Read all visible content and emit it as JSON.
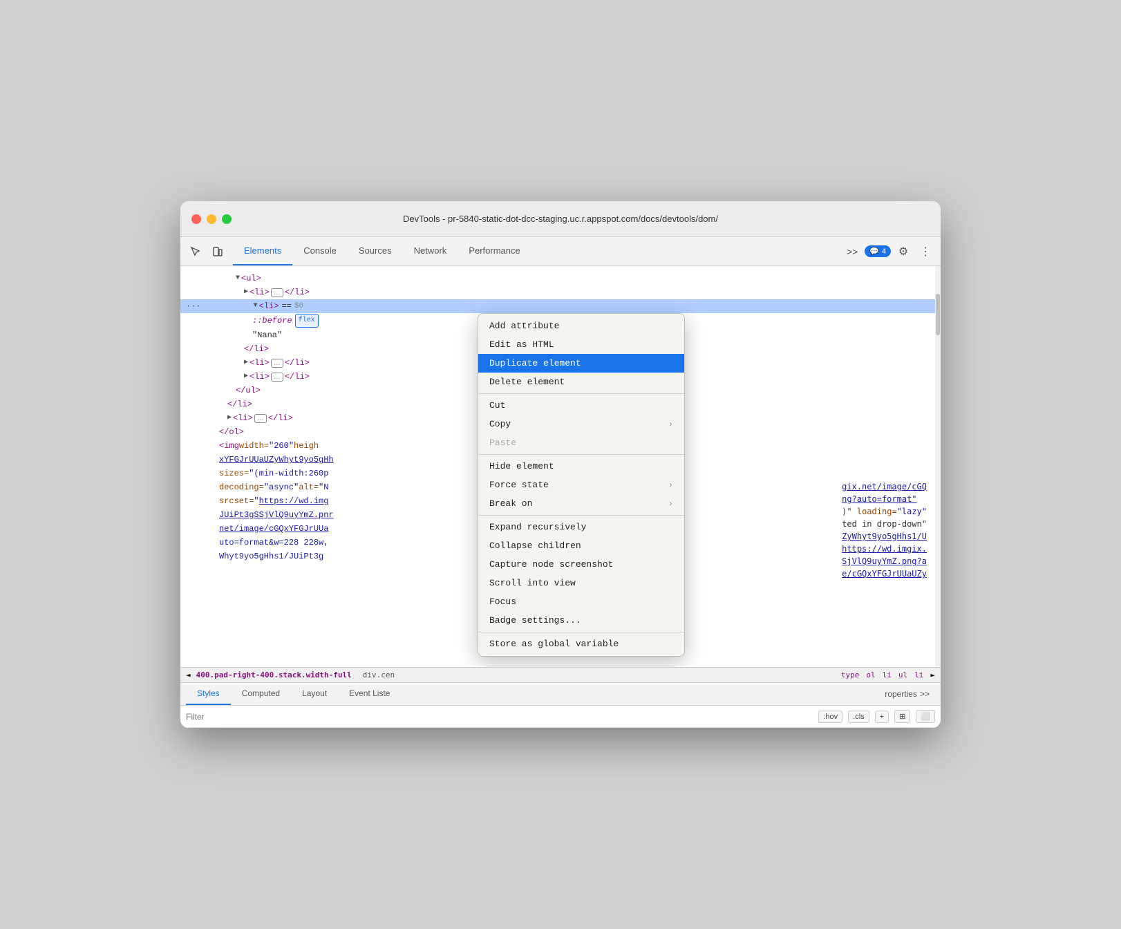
{
  "window": {
    "title": "DevTools - pr-5840-static-dot-dcc-staging.uc.r.appspot.com/docs/devtools/dom/"
  },
  "toolbar": {
    "tabs": [
      {
        "label": "Elements",
        "active": true
      },
      {
        "label": "Console",
        "active": false
      },
      {
        "label": "Sources",
        "active": false
      },
      {
        "label": "Network",
        "active": false
      },
      {
        "label": "Performance",
        "active": false
      }
    ],
    "more_label": ">>",
    "console_badge": "4",
    "settings_icon": "⚙",
    "more_icon": "⋮"
  },
  "dom": {
    "lines": [
      {
        "indent": 6,
        "content": "<ul>",
        "type": "open-tag"
      },
      {
        "indent": 7,
        "content": "<li>…</li>",
        "type": "collapsed"
      },
      {
        "indent": 7,
        "content": "<li> == $0",
        "type": "selected-open",
        "selected": true
      },
      {
        "indent": 8,
        "content": "::before",
        "type": "pseudo",
        "badge": "flex"
      },
      {
        "indent": 8,
        "content": "\"Nana\"",
        "type": "text"
      },
      {
        "indent": 7,
        "content": "</li>",
        "type": "close-tag"
      },
      {
        "indent": 7,
        "content": "<li>…</li>",
        "type": "collapsed"
      },
      {
        "indent": 7,
        "content": "<li>…</li>",
        "type": "collapsed"
      },
      {
        "indent": 6,
        "content": "</ul>",
        "type": "close-tag"
      },
      {
        "indent": 5,
        "content": "</li>",
        "type": "close-tag"
      },
      {
        "indent": 5,
        "content": "<li>…</li>",
        "type": "collapsed"
      },
      {
        "indent": 4,
        "content": "</ol>",
        "type": "close-tag"
      },
      {
        "indent": 4,
        "content": "<img width=\"260\" heigh",
        "type": "attr-line"
      },
      {
        "indent": 4,
        "content": "xYFGJrUUaUZyWhyt9yo5gHh",
        "type": "attr-link"
      },
      {
        "indent": 4,
        "content": "sizes=\"(min-width:260p",
        "type": "attr-line2"
      },
      {
        "indent": 4,
        "content": "decoding=\"async\" alt=\"N",
        "type": "attr-line3"
      },
      {
        "indent": 4,
        "content": "srcset=\"https://wd.img",
        "type": "attr-link2"
      },
      {
        "indent": 4,
        "content": "JUiPt3gSSjVlQ9uyYmZ.pnr",
        "type": "attr-link3"
      },
      {
        "indent": 4,
        "content": "net/image/cGQxYFGJrUUa",
        "type": "attr-link4"
      },
      {
        "indent": 4,
        "content": "uto=format&w=228 228w,",
        "type": "attr-line4"
      },
      {
        "indent": 4,
        "content": "Whyt9yo5gHhs1/JUiPt3g",
        "type": "attr-line5"
      }
    ]
  },
  "context_menu": {
    "items": [
      {
        "label": "Add attribute",
        "type": "normal",
        "highlighted": false
      },
      {
        "label": "Edit as HTML",
        "type": "normal",
        "highlighted": false
      },
      {
        "label": "Duplicate element",
        "type": "normal",
        "highlighted": true
      },
      {
        "label": "Delete element",
        "type": "normal",
        "highlighted": false
      },
      {
        "type": "separator"
      },
      {
        "label": "Cut",
        "type": "normal",
        "highlighted": false
      },
      {
        "label": "Copy",
        "type": "submenu",
        "highlighted": false
      },
      {
        "label": "Paste",
        "type": "normal",
        "highlighted": false,
        "disabled": true
      },
      {
        "type": "separator"
      },
      {
        "label": "Hide element",
        "type": "normal",
        "highlighted": false
      },
      {
        "label": "Force state",
        "type": "submenu",
        "highlighted": false
      },
      {
        "label": "Break on",
        "type": "submenu",
        "highlighted": false
      },
      {
        "type": "separator"
      },
      {
        "label": "Expand recursively",
        "type": "normal",
        "highlighted": false
      },
      {
        "label": "Collapse children",
        "type": "normal",
        "highlighted": false
      },
      {
        "label": "Capture node screenshot",
        "type": "normal",
        "highlighted": false
      },
      {
        "label": "Scroll into view",
        "type": "normal",
        "highlighted": false
      },
      {
        "label": "Focus",
        "type": "normal",
        "highlighted": false
      },
      {
        "label": "Badge settings...",
        "type": "normal",
        "highlighted": false
      },
      {
        "type": "separator"
      },
      {
        "label": "Store as global variable",
        "type": "normal",
        "highlighted": false
      }
    ]
  },
  "breadcrumb": {
    "items": [
      {
        "label": "400.pad-right-400.stack.width-full",
        "type": "class"
      },
      {
        "label": "div.cen",
        "type": "class"
      }
    ],
    "right_items": [
      "type",
      "ol",
      "li",
      "ul",
      "li"
    ]
  },
  "bottom_panel": {
    "tabs": [
      {
        "label": "Styles",
        "active": true
      },
      {
        "label": "Computed",
        "active": false
      },
      {
        "label": "Layout",
        "active": false
      },
      {
        "label": "Event Liste",
        "active": false
      },
      {
        "label": "roperties",
        "active": false,
        "more": true
      }
    ],
    "filter_placeholder": "Filter",
    "filter_buttons": [
      ":hov",
      ".cls",
      "+",
      "⊞",
      "⬜"
    ]
  }
}
